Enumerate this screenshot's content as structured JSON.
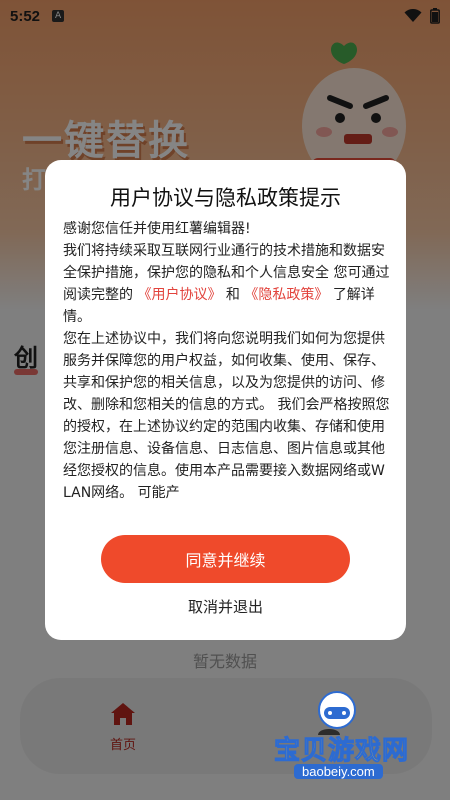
{
  "status_bar": {
    "time": "5:52",
    "notif_letter": "A"
  },
  "banner": {
    "title": "一键替换",
    "subtitle": "打"
  },
  "section": {
    "create_label": "创"
  },
  "empty_state": {
    "text": "暂无数据"
  },
  "bottom_nav": {
    "items": [
      {
        "label": "首页",
        "icon": "home-icon",
        "active": true
      },
      {
        "label": "",
        "icon": "profile-icon",
        "active": false
      }
    ]
  },
  "watermark": {
    "text": "宝贝游戏网",
    "url": "baobeiy.com"
  },
  "dialog": {
    "title": "用户协议与隐私政策提示",
    "p1": "感谢您信任并使用红薯编辑器!",
    "p2_a": "我们将持续采取互联网行业通行的技术措施和数据安全保护措施，保护您的隐私和个人信息安全 您可通过阅读完整的",
    "link_user": "《用户协议》",
    "p2_and": "和",
    "link_privacy": "《隐私政策》",
    "p2_b": "了解详情。",
    "p3": "您在上述协议中，我们将向您说明我们如何为您提供服务并保障您的用户权益，如何收集、使用、保存、共享和保护您的相关信息，以及为您提供的访问、修改、删除和您相关的信息的方式。 我们会严格按照您的授权，在上述协议约定的范围内收集、存储和使用您注册信息、设备信息、日志信息、图片信息或其他经您授权的信息。使用本产品需要接入数据网络或WLAN网络。 可能产",
    "agree_label": "同意并继续",
    "cancel_label": "取消并退出"
  },
  "colors": {
    "accent": "#ef4a2b",
    "link": "#e2433c",
    "nav_active": "#b8281f"
  }
}
